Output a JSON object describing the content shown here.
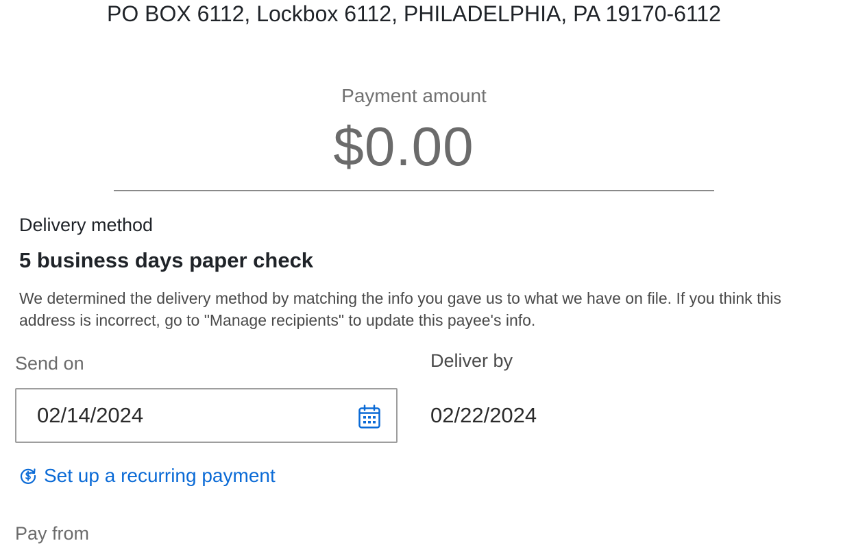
{
  "payee": {
    "address": "PO BOX 6112, Lockbox 6112, PHILADELPHIA, PA 19170-6112"
  },
  "payment_amount": {
    "label": "Payment amount",
    "value": "$0.00"
  },
  "delivery": {
    "label": "Delivery method",
    "method": "5 business days paper check",
    "note": "We determined the delivery method by matching the info you gave us to what we have on file. If you think this address is incorrect, go to \"Manage recipients\" to update this payee's info."
  },
  "send_on": {
    "label": "Send on",
    "value": "02/14/2024",
    "icon": "calendar-icon"
  },
  "deliver_by": {
    "label": "Deliver by",
    "value": "02/22/2024"
  },
  "recurring": {
    "label": "Set up a recurring payment",
    "icon": "recurring-dollar-icon"
  },
  "pay_from": {
    "label": "Pay from"
  },
  "colors": {
    "link": "#0a6ad6",
    "text": "#1f2328",
    "muted": "#6b6b6b",
    "border": "#9e9e9e"
  }
}
